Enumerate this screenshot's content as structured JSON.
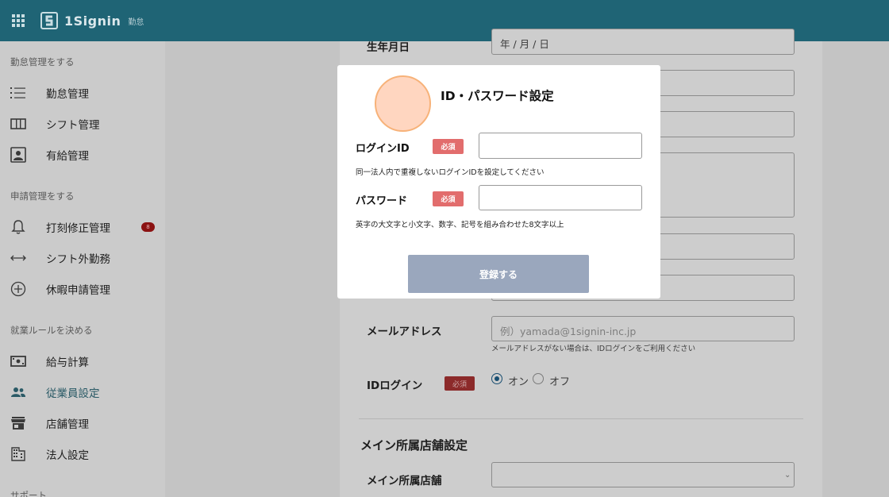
{
  "header": {
    "logo_text": "1Signin",
    "logo_sub": "勤怠"
  },
  "sidebar": {
    "sections": [
      {
        "title": "勤怠管理をする"
      },
      {
        "title": "申請管理をする"
      },
      {
        "title": "就業ルールを決める"
      },
      {
        "title": "サポート"
      }
    ],
    "items": [
      {
        "label": "勤怠管理",
        "icon": "list-icon"
      },
      {
        "label": "シフト管理",
        "icon": "columns-icon"
      },
      {
        "label": "有給管理",
        "icon": "person-card-icon"
      },
      {
        "label": "打刻修正管理",
        "icon": "bell-icon",
        "badge": "8"
      },
      {
        "label": "シフト外勤務",
        "icon": "arrows-horizontal-icon"
      },
      {
        "label": "休暇申請管理",
        "icon": "plus-circle-icon"
      },
      {
        "label": "給与計算",
        "icon": "money-icon"
      },
      {
        "label": "従業員設定",
        "icon": "people-icon",
        "active": true
      },
      {
        "label": "店舗管理",
        "icon": "store-icon"
      },
      {
        "label": "法人設定",
        "icon": "building-icon"
      }
    ]
  },
  "form": {
    "birthday_label": "生年月日",
    "birthday_value": "年 / 月 / 日",
    "email_label": "メールアドレス",
    "email_placeholder": "例）yamada@1signin-inc.jp",
    "email_hint": "メールアドレスがない場合は、IDログインをご利用ください",
    "id_login_label": "IDログイン",
    "required_label": "必須",
    "radio_on": "オン",
    "radio_off": "オフ",
    "id_login_value": "オン",
    "main_store_section": "メイン所属店舗設定",
    "main_store_label": "メイン所属店舗"
  },
  "modal": {
    "title": "ID・パスワード設定",
    "login_id_label": "ログインID",
    "login_id_value": "",
    "login_id_hint": "同一法人内で重複しないログインIDを設定してください",
    "password_label": "パスワード",
    "password_value": "",
    "password_hint": "英字の大文字と小文字、数字、記号を組み合わせた8文字以上",
    "required_label": "必須",
    "submit_label": "登録する"
  },
  "colors": {
    "header": "#1f6475",
    "required_badge": "#e26d6d",
    "submit_button": "#9aa7bd",
    "avatar_fill": "#ffd6c0",
    "avatar_border": "#f7b279"
  }
}
